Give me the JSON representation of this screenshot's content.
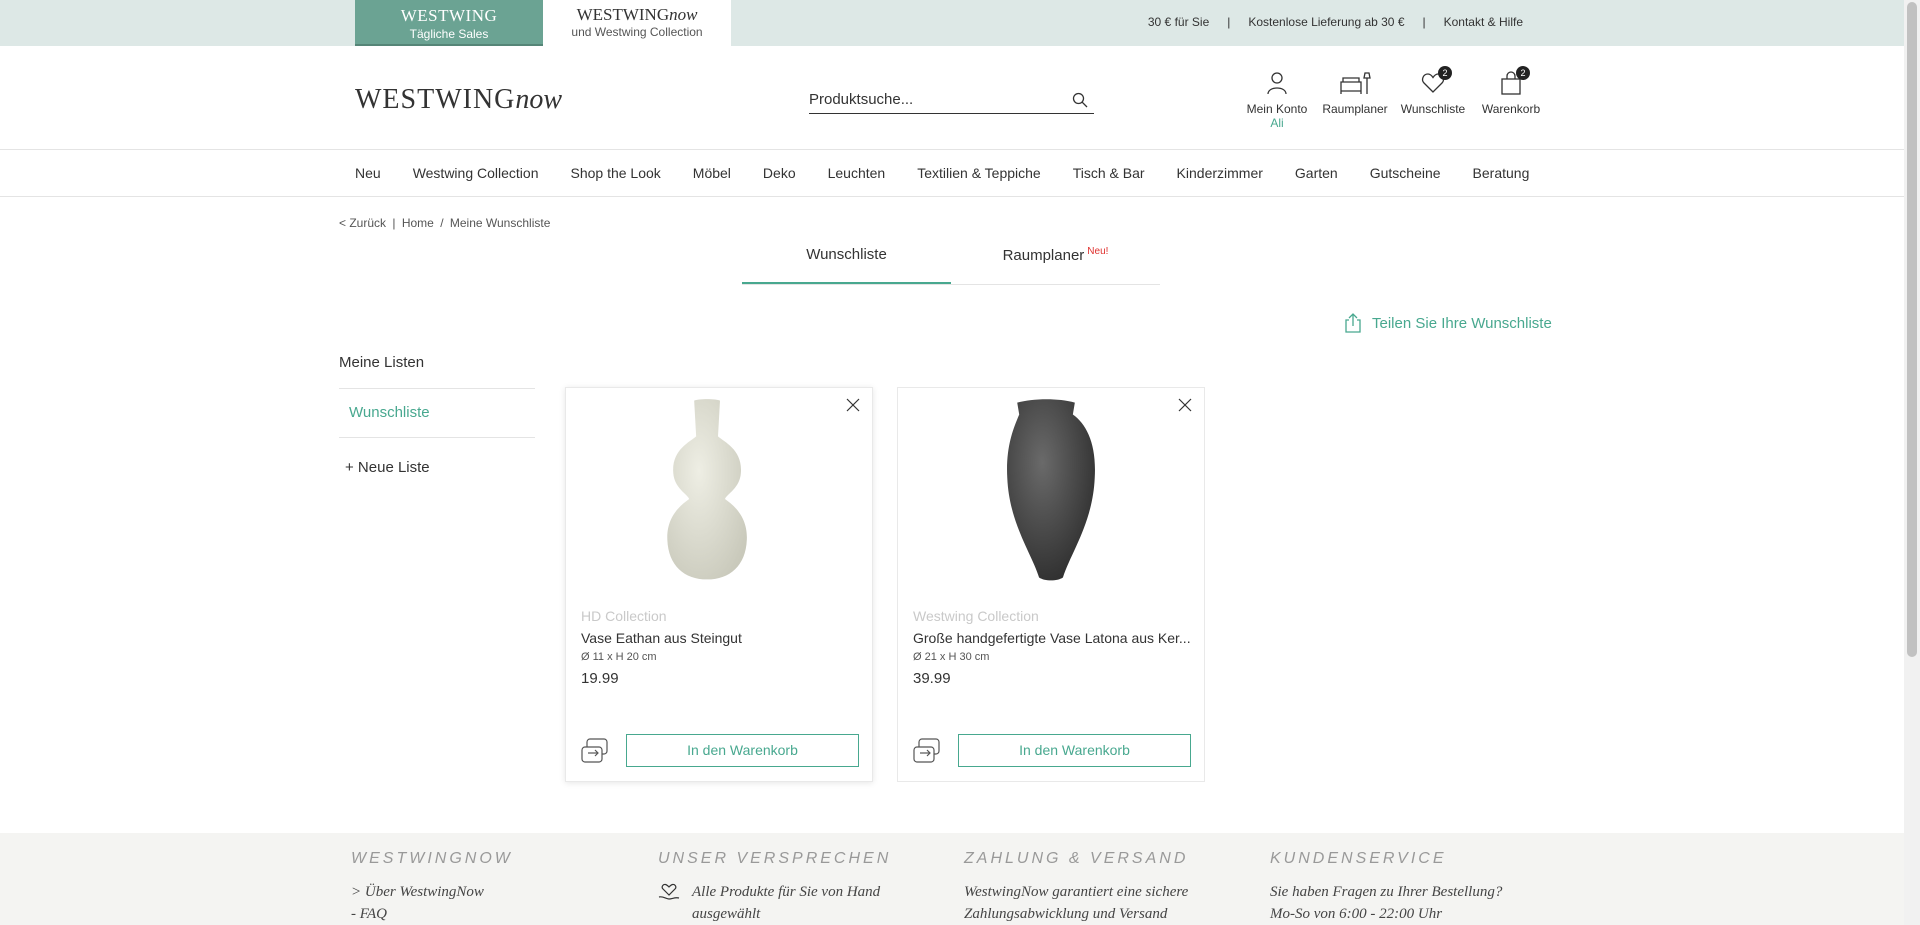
{
  "topbar": {
    "sales_brand": "WESTWING",
    "sales_sub": "Tägliche Sales",
    "now_brand_a": "WESTWING",
    "now_brand_b": "now",
    "now_sub": "und Westwing Collection",
    "links": [
      "30 € für Sie",
      "Kostenlose Lieferung ab 30 €",
      "Kontakt & Hilfe"
    ],
    "separator": "|"
  },
  "header": {
    "logo_a": "WESTWING",
    "logo_b": "now",
    "search_placeholder": "Produktsuche...",
    "icons": {
      "account": "Mein Konto",
      "account_user": "Ali",
      "roomplanner": "Raumplaner",
      "wishlist": "Wunschliste",
      "wishlist_count": "2",
      "cart": "Warenkorb",
      "cart_count": "2"
    }
  },
  "nav": {
    "items": [
      "Neu",
      "Westwing Collection",
      "Shop the Look",
      "Möbel",
      "Deko",
      "Leuchten",
      "Textilien & Teppiche",
      "Tisch & Bar",
      "Kinderzimmer",
      "Garten",
      "Gutscheine",
      "Beratung"
    ]
  },
  "breadcrumb": {
    "back": "< Zurück",
    "divider": "|",
    "home": "Home",
    "slash": "/",
    "current": "Meine Wunschliste"
  },
  "tabs": {
    "wishlist": "Wunschliste",
    "roomplanner": "Raumplaner",
    "new_badge": "Neu!"
  },
  "share_label": "Teilen Sie Ihre Wunschliste",
  "sidebar": {
    "title": "Meine Listen",
    "active_list": "Wunschliste",
    "new_list": "+ Neue Liste"
  },
  "products": [
    {
      "brand": "HD Collection",
      "name": "Vase Eathan aus Steingut",
      "dimensions": "Ø 11 x H 20 cm",
      "price": "19.99",
      "cart_label": "In den Warenkorb",
      "image_icon": "vase-cream-icon"
    },
    {
      "brand": "Westwing Collection",
      "name": "Große handgefertigte Vase Latona aus Ker...",
      "dimensions": "Ø 21 x H 30 cm",
      "price": "39.99",
      "cart_label": "In den Warenkorb",
      "image_icon": "vase-dark-icon"
    }
  ],
  "footer": {
    "col1_title": "WESTWINGNOW",
    "col1_link1": "> Über WestwingNow",
    "col1_link2": "- FAQ",
    "col2_title": "UNSER VERSPRECHEN",
    "col2_text": "Alle Produkte für Sie von Hand ausgewählt",
    "col3_title": "ZAHLUNG & VERSAND",
    "col3_text": "WestwingNow garantiert eine sichere Zahlungsabwicklung und Versand",
    "col4_title": "KUNDENSERVICE",
    "col4_text1": "Sie haben Fragen zu Ihrer Bestellung?",
    "col4_text2": "Mo-So von 6:00 - 22:00 Uhr"
  },
  "colors": {
    "accent": "#48a88f",
    "sales_tab": "#6ba393",
    "topbar_bg": "#dde8e6",
    "new_badge": "#e0312f",
    "footer_bg": "#f4f4f2"
  }
}
